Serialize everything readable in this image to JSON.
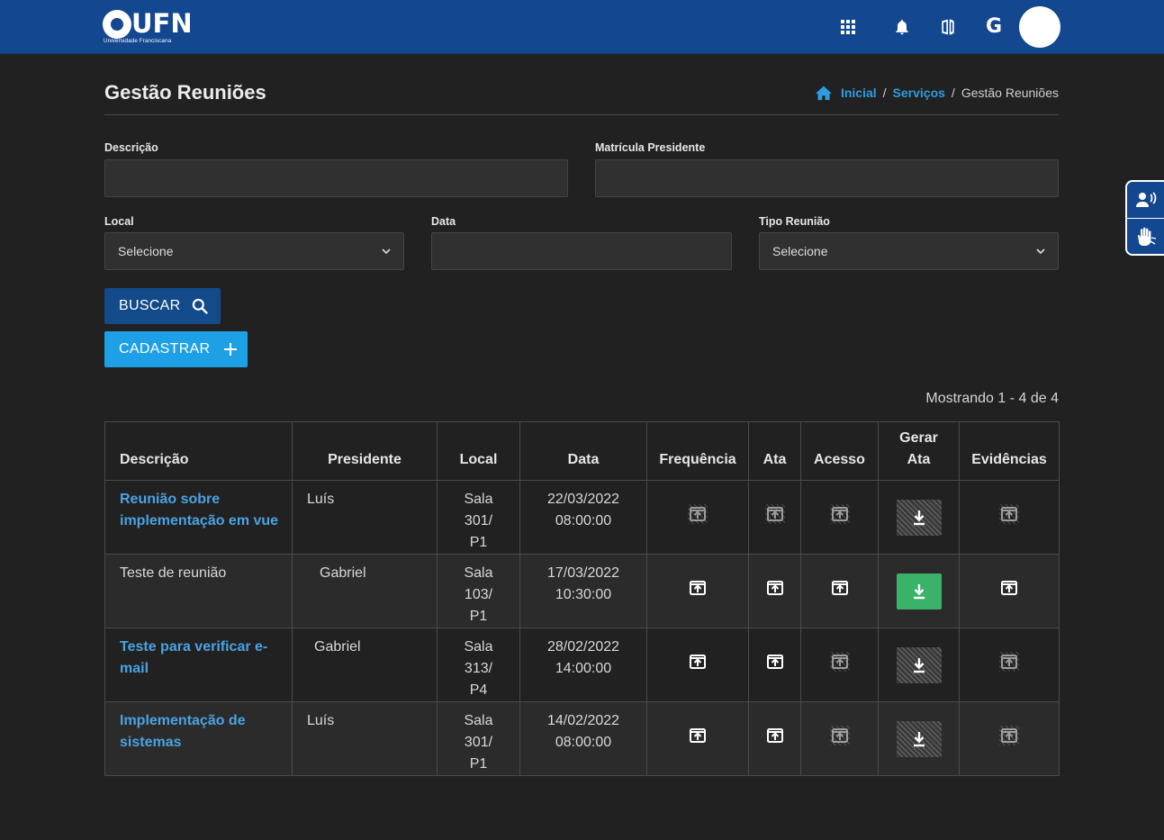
{
  "header": {
    "logo_text": "UFN",
    "logo_subtitle": "Universidade Franciscana",
    "icons": [
      "apps-icon",
      "bell-icon",
      "book-icon",
      "google-icon"
    ],
    "g_label": "G"
  },
  "page": {
    "title": "Gestão Reuniões",
    "breadcrumb": {
      "home": "Inicial",
      "services": "Serviços",
      "current": "Gestão Reuniões",
      "separator": "/"
    }
  },
  "form": {
    "descricao": {
      "label": "Descrição",
      "value": ""
    },
    "matricula": {
      "label": "Matrícula Presidente",
      "value": ""
    },
    "local": {
      "label": "Local",
      "selected": "Selecione"
    },
    "data": {
      "label": "Data",
      "value": ""
    },
    "tipo": {
      "label": "Tipo Reunião",
      "selected": "Selecione"
    },
    "buscar_label": "BUSCAR",
    "cadastrar_label": "CADASTRAR"
  },
  "results": {
    "showing": "Mostrando 1 - 4 de 4"
  },
  "table": {
    "headers": {
      "descricao": "Descrição",
      "presidente": "Presidente",
      "local": "Local",
      "data": "Data",
      "frequencia": "Frequência",
      "ata": "Ata",
      "acesso": "Acesso",
      "gerar_ata": "Gerar Ata",
      "evidencias": "Evidências"
    },
    "rows": [
      {
        "descricao": "Reunião sobre implementação em vue",
        "link": true,
        "presidente": "Luís",
        "local": "Sala 301/ P1",
        "data": "22/03/2022",
        "hora": "08:00:00",
        "frequencia": false,
        "ata": false,
        "acesso": false,
        "gerar_ata": false,
        "evidencias": false
      },
      {
        "descricao": "Teste de reunião",
        "link": false,
        "presidente": "Gabriel",
        "local": "Sala 103/ P1",
        "data": "17/03/2022",
        "hora": "10:30:00",
        "frequencia": true,
        "ata": true,
        "acesso": true,
        "gerar_ata": true,
        "evidencias": true
      },
      {
        "descricao": "Teste para verificar e-mail",
        "link": true,
        "presidente": "Gabriel",
        "local": "Sala 313/ P4",
        "data": "28/02/2022",
        "hora": "14:00:00",
        "frequencia": true,
        "ata": true,
        "acesso": false,
        "gerar_ata": false,
        "evidencias": false
      },
      {
        "descricao": "Implementação de sistemas",
        "link": true,
        "presidente": "Luís",
        "local": "Sala 301/ P1",
        "data": "14/02/2022",
        "hora": "08:00:00",
        "frequencia": true,
        "ata": true,
        "acesso": false,
        "gerar_ata": false,
        "evidencias": false
      }
    ]
  },
  "accessibility": {
    "icons": [
      "audio-description-icon",
      "sign-language-icon"
    ]
  },
  "colors": {
    "header": "#13478f",
    "background": "#212121",
    "link": "#4aa3e3",
    "buscar": "#134a8a",
    "cadastrar": "#1ea0e6",
    "gerar_ata": "#3ab26a"
  }
}
